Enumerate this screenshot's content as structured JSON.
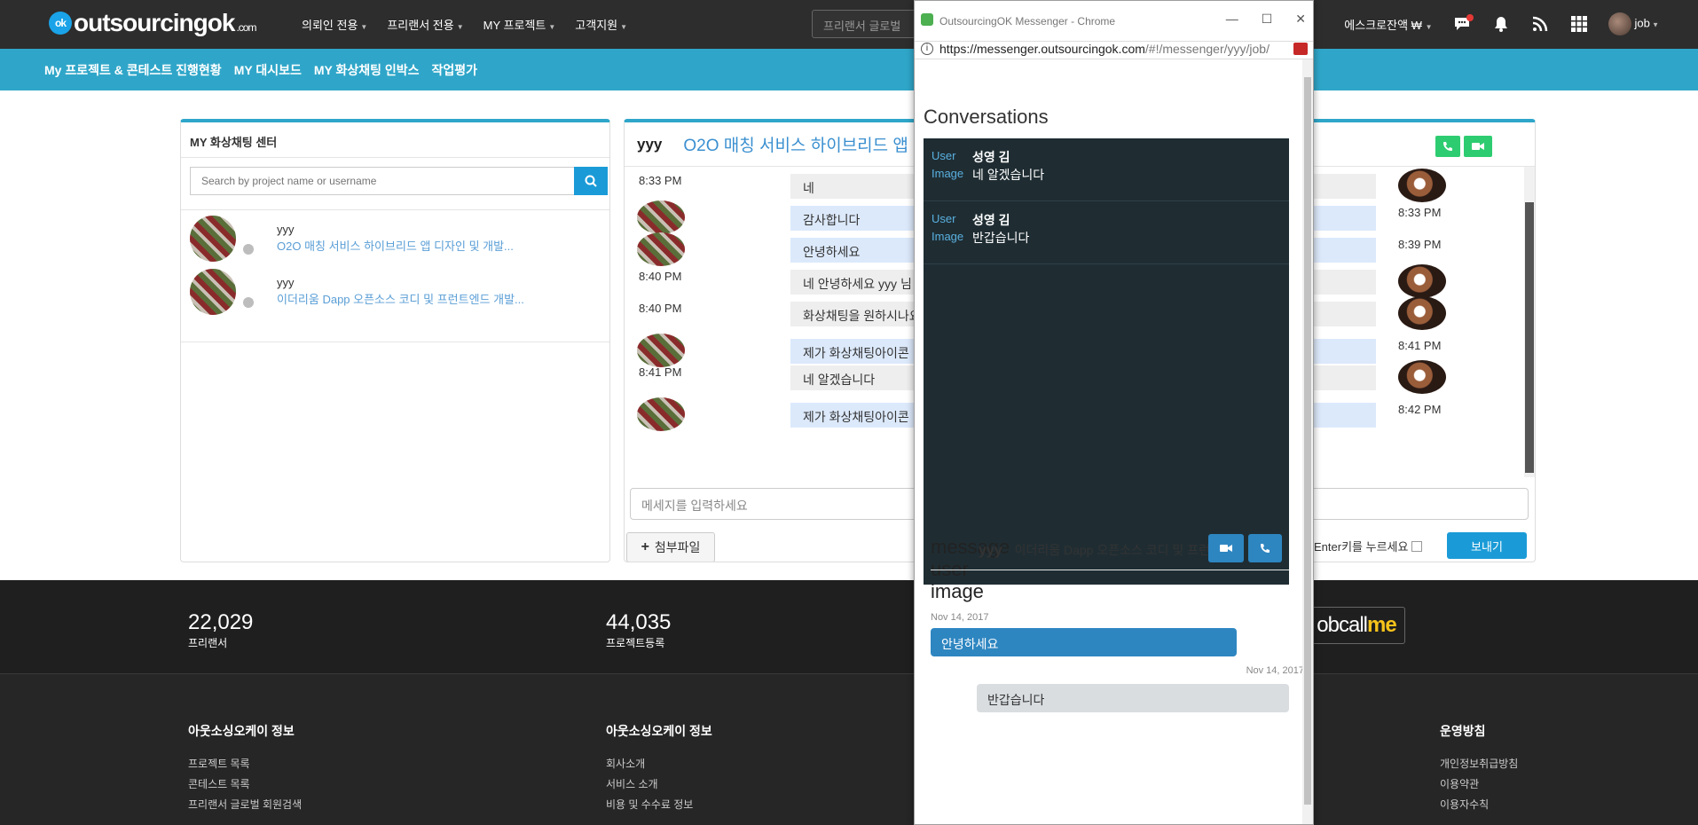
{
  "topnav": {
    "logo_text": "outsourcingok",
    "logo_suffix": ".com",
    "logo_mark": "ok",
    "menu": [
      "의뢰인 전용",
      "프리랜서 전용",
      "MY 프로젝트",
      "고객지원"
    ],
    "search_placeholder": "프리랜서 글로벌",
    "escrow": "에스크로잔액 ₩",
    "user": "job"
  },
  "subnav": [
    "My 프로젝트 & 콘테스트 진행현황",
    "MY 대시보드",
    "MY 화상채팅 인박스",
    "작업평가"
  ],
  "left_panel": {
    "title": "MY 화상채팅 센터",
    "search_placeholder": "Search by project name or username",
    "conversations": [
      {
        "username": "yyy",
        "project": "O2O 매칭 서비스 하이브리드 앱 디자인 및 개발..."
      },
      {
        "username": "yyy",
        "project": "이더리움 Dapp 오픈소스 코디 및 프런트엔드 개발..."
      }
    ]
  },
  "chat": {
    "user": "yyy",
    "project_title": "O2O 매칭 서비스 하이브리드 앱 디자인",
    "messages": [
      {
        "side": "left",
        "time": "8:33 PM",
        "text": "네"
      },
      {
        "side": "right",
        "time": "8:33 PM",
        "text": "감사합니다"
      },
      {
        "side": "right",
        "time": "8:39 PM",
        "text": "안녕하세요"
      },
      {
        "side": "left",
        "time": "8:40 PM",
        "text": "네 안녕하세요 yyy 님"
      },
      {
        "side": "left",
        "time": "8:40 PM",
        "text": "화상채팅을 원하시나요"
      },
      {
        "side": "right",
        "time": "8:41 PM",
        "text": "제가 화상채팅아이콘"
      },
      {
        "side": "left",
        "time": "8:41 PM",
        "text": "네 알겠습니다"
      },
      {
        "side": "right",
        "time": "8:42 PM",
        "text": "제가 화상채팅아이콘"
      }
    ],
    "input_placeholder": "메세지를 입력하세요",
    "attach_label": "첨부파일",
    "enter_label": "Enter키를 누르세요",
    "send_label": "보내기"
  },
  "footer": {
    "stats": [
      {
        "num": "22,029",
        "label": "프리랜서"
      },
      {
        "num": "44,035",
        "label": "프로젝트등록"
      }
    ],
    "jobcall_prefix": "obcall",
    "jobcall_suffix": "me",
    "columns": [
      {
        "head": "아웃소싱오케이 정보",
        "links": [
          "프로젝트 목록",
          "콘테스트 목록",
          "프리랜서 글로벌 회원검색"
        ]
      },
      {
        "head": "아웃소싱오케이 정보",
        "links": [
          "회사소개",
          "서비스 소개",
          "비용 및 수수료 정보"
        ]
      },
      {
        "head": "운영방침",
        "links": [
          "개인정보취급방침",
          "이용약관",
          "이용자수칙"
        ]
      }
    ]
  },
  "popup": {
    "window_title": "OutsourcingOK Messenger - Chrome",
    "url_host": "https://messenger.outsourcingok.com",
    "url_path": "/#!/messenger/yyy/job/",
    "conversations_heading": "Conversations",
    "conversations": [
      {
        "label_user": "User",
        "label_image": "Image",
        "user": "성영 김",
        "message": "네 알겠습니다"
      },
      {
        "label_user": "User",
        "label_image": "Image",
        "user": "성영 김",
        "message": "반갑습니다"
      }
    ],
    "overlap_lines": [
      "message",
      "user",
      "image"
    ],
    "overlap_user": "yyy",
    "overlap_project": "이더리움 Dapp 오픈소스 코디 및 프런트엔드 개발",
    "messages": [
      {
        "date": "Nov 14, 2017",
        "text": "안녕하세요",
        "side": "left"
      },
      {
        "date": "Nov 14, 2017",
        "text": "반갑습니다",
        "side": "right"
      }
    ]
  }
}
